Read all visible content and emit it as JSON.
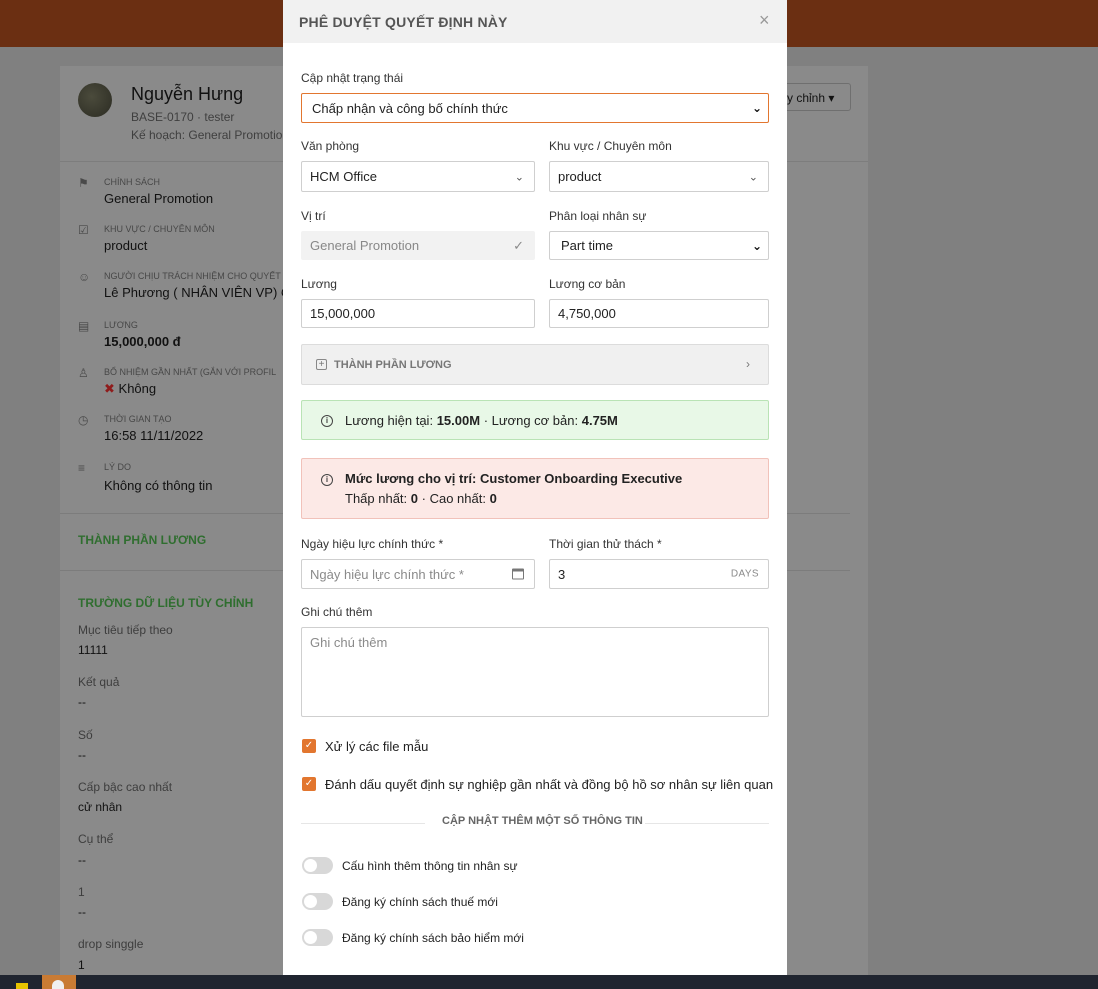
{
  "background": {
    "profile": {
      "name": "Nguyễn Hưng",
      "code": "BASE-0170 · tester",
      "plan": "Kế hoạch: General Promotion",
      "edit_button": "y chỉnh"
    },
    "items": [
      {
        "label": "CHÍNH SÁCH",
        "value": "General Promotion"
      },
      {
        "label": "KHU VỰC / CHUYÊN MÔN",
        "value": "product"
      },
      {
        "label": "NGƯỜI CHỊU TRÁCH NHIỆM CHO QUYẾT",
        "value": "Lê Phương ( NHÂN VIÊN VP) Ch"
      },
      {
        "label": "LƯƠNG",
        "value": "15,000,000 đ"
      },
      {
        "label": "BỔ NHIỆM GẦN NHẤT (GẮN VỚI PROFIL",
        "value": "Không"
      },
      {
        "label": "THỜI GIAN TẠO",
        "value": "16:58 11/11/2022"
      },
      {
        "label": "LÝ DO",
        "value": "Không có thông tin"
      }
    ],
    "salary_section": "THÀNH PHẦN LƯƠNG",
    "custom_section": "TRƯỜNG DỮ LIỆU TÙY CHỈNH",
    "custom_fields": [
      {
        "label": "Mục tiêu tiếp theo",
        "value": "11111"
      },
      {
        "label": "Kết quả",
        "value": "--"
      },
      {
        "label": "Số",
        "value": "--"
      },
      {
        "label": "Cấp bậc cao nhất",
        "value": "cử nhân"
      },
      {
        "label": "Cụ thể",
        "value": "--"
      },
      {
        "label": "1",
        "value": "--"
      },
      {
        "label": "drop singgle",
        "value": "1"
      }
    ]
  },
  "modal": {
    "title": "PHÊ DUYỆT QUYẾT ĐỊNH NÀY",
    "close": "×",
    "status": {
      "label": "Cập nhật trạng thái",
      "value": "Chấp nhận và công bố chính thức"
    },
    "office": {
      "label": "Văn phòng",
      "value": "HCM Office"
    },
    "area": {
      "label": "Khu vực / Chuyên môn",
      "value": "product"
    },
    "position": {
      "label": "Vị trí",
      "value": "General Promotion"
    },
    "staff_type": {
      "label": "Phân loại nhân sự",
      "value": "Part time"
    },
    "salary": {
      "label": "Lương",
      "value": "15,000,000"
    },
    "base_salary": {
      "label": "Lương cơ bản",
      "value": "4,750,000"
    },
    "salary_components": "THÀNH PHẦN LƯƠNG",
    "current_salary": {
      "prefix": "Lương hiện tại:",
      "salary": "15.00M",
      "mid": "· Lương cơ bản:",
      "base": "4.75M"
    },
    "salary_range": {
      "prefix": "Mức lương cho vị trí:",
      "position": "Customer Onboarding Executive",
      "min_label": "Thấp nhất:",
      "min": "0",
      "max_label": "· Cao nhất:",
      "max": "0"
    },
    "effective_date": {
      "label": "Ngày hiệu lực chính thức *",
      "placeholder": "Ngày hiệu lực chính thức *"
    },
    "probation": {
      "label": "Thời gian thử thách *",
      "value": "3",
      "unit": "DAYS"
    },
    "note": {
      "label": "Ghi chú thêm",
      "placeholder": "Ghi chú thêm"
    },
    "checkboxes": [
      {
        "label": "Xử lý các file mẫu",
        "checked": true
      },
      {
        "label": "Đánh dấu quyết định sự nghiệp gần nhất và đồng bộ hồ sơ nhân sự liên quan",
        "checked": true
      }
    ],
    "more_info": "CẬP NHẬT THÊM MỘT SỐ THÔNG TIN",
    "toggles": [
      {
        "label": "Cấu hình thêm thông tin nhân sự",
        "on": false
      },
      {
        "label": "Đăng ký chính sách thuế mới",
        "on": false
      },
      {
        "label": "Đăng ký chính sách bảo hiểm mới",
        "on": false
      }
    ]
  }
}
